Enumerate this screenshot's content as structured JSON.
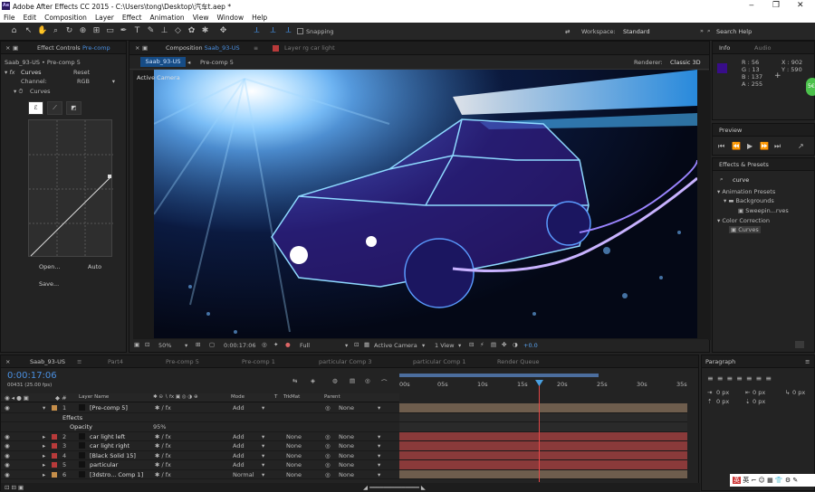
{
  "window": {
    "title": "Adobe After Effects CC 2015 - C:\\Users\\tong\\Desktop\\汽车t.aep *",
    "app_badge": "Ae",
    "controls": [
      "‒",
      "❐",
      "✕"
    ]
  },
  "menu": [
    "File",
    "Edit",
    "Composition",
    "Layer",
    "Effect",
    "Animation",
    "View",
    "Window",
    "Help"
  ],
  "toolbar": {
    "snapping": "Snapping",
    "workspace_label": "Workspace:",
    "workspace_value": "Standard",
    "search_placeholder": "Search Help"
  },
  "effect_controls": {
    "tab": "Effect Controls",
    "tab_layer": "Pre-comp",
    "breadcrumb": "Saab_93-US • Pre-comp 5",
    "effect": "Curves",
    "reset": "Reset",
    "channel_label": "Channel:",
    "channel_value": "RGB",
    "curves_sub": "Curves",
    "open": "Open...",
    "auto": "Auto",
    "save": "Save..."
  },
  "composition": {
    "tab": "Composition",
    "tab_name": "Saab_93-US",
    "layer_tab": "Layer rg car light",
    "nav1": "Saab_93-US",
    "nav2": "Pre-comp 5",
    "renderer_label": "Renderer:",
    "renderer_value": "Classic 3D",
    "active_camera": "Active Camera",
    "zoom": "50%",
    "timecode": "0:00:17:06",
    "resolution": "Full",
    "camera_select": "Active Camera",
    "views": "1 View",
    "exposure": "+0.0"
  },
  "info": {
    "tab": "Info",
    "tab2": "Audio",
    "r": "R : 56",
    "g": "G : 13",
    "b": "B : 137",
    "a": "A : 255",
    "x": "X : 902",
    "y": "Y : 590",
    "swatch": "#380d89"
  },
  "preview": {
    "tab": "Preview"
  },
  "effects_presets": {
    "tab": "Effects & Presets",
    "search": "curve",
    "items": [
      "Animation Presets",
      "Backgrounds",
      "Sweepin...rves",
      "Color Correction",
      "Curves"
    ]
  },
  "paragraph": {
    "tab": "Paragraph",
    "v1": "0 px",
    "v2": "0 px",
    "v3": "0 px",
    "v4": "0 px",
    "v5": "0 px"
  },
  "timeline": {
    "tabs": [
      "Saab_93-US",
      "Part4",
      "Pre-comp 5",
      "Pre-comp 1",
      "particular Comp 3",
      "particular Comp 1",
      "Render Queue"
    ],
    "timecode": "0:00:17:06",
    "frames": "00431 (25.00 fps)",
    "headers": {
      "layer_name": "Layer Name",
      "mode": "Mode",
      "t": "T",
      "trkmat": "TrkMat",
      "parent": "Parent"
    },
    "ruler": [
      "00s",
      "05s",
      "10s",
      "15s",
      "20s",
      "25s",
      "30s",
      "35s"
    ],
    "layers": [
      {
        "num": "1",
        "name": "[Pre-comp 5]",
        "mode": "Add",
        "trk": "",
        "parent": "None",
        "color": "#c58e4a"
      },
      {
        "num": "",
        "name": "Effects",
        "mode": "",
        "trk": "",
        "parent": "",
        "color": ""
      },
      {
        "num": "",
        "name": "Opacity",
        "value": "95%",
        "mode": "",
        "trk": "",
        "parent": "",
        "color": ""
      },
      {
        "num": "2",
        "name": "car light left",
        "mode": "Add",
        "trk": "None",
        "parent": "None",
        "color": "#b83a3a"
      },
      {
        "num": "3",
        "name": "car light right",
        "mode": "Add",
        "trk": "None",
        "parent": "None",
        "color": "#b83a3a"
      },
      {
        "num": "4",
        "name": "[Black Solid 15]",
        "mode": "Add",
        "trk": "None",
        "parent": "None",
        "color": "#b83a3a"
      },
      {
        "num": "5",
        "name": "particular",
        "mode": "Add",
        "trk": "None",
        "parent": "None",
        "color": "#b83a3a"
      },
      {
        "num": "6",
        "name": "[3dstro... Comp 1]",
        "mode": "Normal",
        "trk": "None",
        "parent": "None",
        "color": "#c58e4a"
      }
    ]
  }
}
